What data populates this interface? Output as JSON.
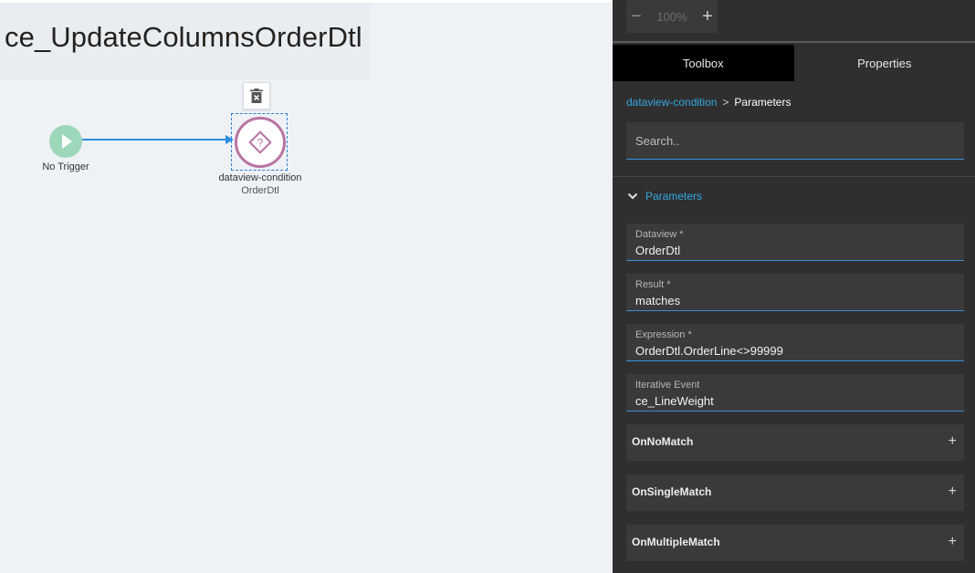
{
  "canvas": {
    "title": "ce_UpdateColumnsOrderDtl",
    "trigger_node": {
      "label": "No Trigger"
    },
    "condition_node": {
      "label": "dataview-condition",
      "sublabel": "OrderDtl"
    }
  },
  "zoom": {
    "minus": "−",
    "level": "100%",
    "plus": "+"
  },
  "tabs": [
    {
      "label": "Toolbox",
      "active": true
    },
    {
      "label": "Properties",
      "active": false
    }
  ],
  "breadcrumb": {
    "link": "dataview-condition",
    "separator": ">",
    "current": "Parameters"
  },
  "search": {
    "placeholder": "Search.."
  },
  "section": {
    "title": "Parameters"
  },
  "fields": [
    {
      "label": "Dataview *",
      "value": "OrderDtl"
    },
    {
      "label": "Result *",
      "value": "matches"
    },
    {
      "label": "Expression *",
      "value": "OrderDtl.OrderLine<>99999"
    },
    {
      "label": "Iterative Event",
      "value": "ce_LineWeight"
    }
  ],
  "collapsibles": [
    {
      "label": "OnNoMatch",
      "icon": "+"
    },
    {
      "label": "OnSingleMatch",
      "icon": "+"
    },
    {
      "label": "OnMultipleMatch",
      "icon": "+"
    }
  ],
  "colors": {
    "accent": "#35a7e0",
    "trigger": "#9dd7b9",
    "condition": "#b873a3",
    "connector": "#2f8ee0",
    "panel_bg": "#2f2f2f"
  },
  "icons": {
    "trigger": "play-icon",
    "condition": "question-diamond-icon",
    "delete": "trash-icon",
    "section_toggle": "chevron-down-icon"
  }
}
